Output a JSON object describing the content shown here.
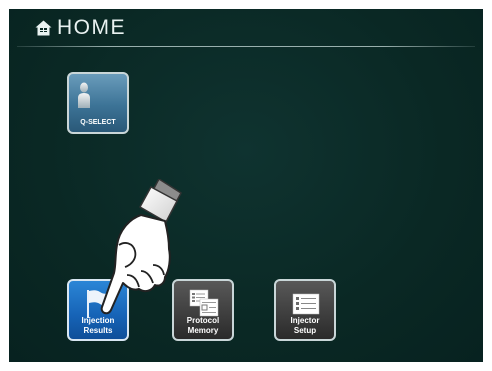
{
  "header": {
    "icon": "home-icon",
    "title": "HOME"
  },
  "tiles": [
    {
      "label": "Q-SELECT",
      "icon": "person-icon",
      "state": "normal"
    },
    {
      "label_line1": "Injection",
      "label_line2": "Results",
      "icon": "flag-icon",
      "state": "selected"
    },
    {
      "label_line1": "Protocol",
      "label_line2": "Memory",
      "icon": "documents-icon",
      "state": "normal"
    },
    {
      "label_line1": "Injector",
      "label_line2": "Setup",
      "icon": "list-icon",
      "state": "normal"
    }
  ],
  "pointer": {
    "icon": "pointing-hand-icon"
  },
  "colors": {
    "background": "#0a2824",
    "selected_tile": "#1663b6",
    "normal_tile": "#3d3d3d",
    "qselect_tile": "#3c7396"
  }
}
